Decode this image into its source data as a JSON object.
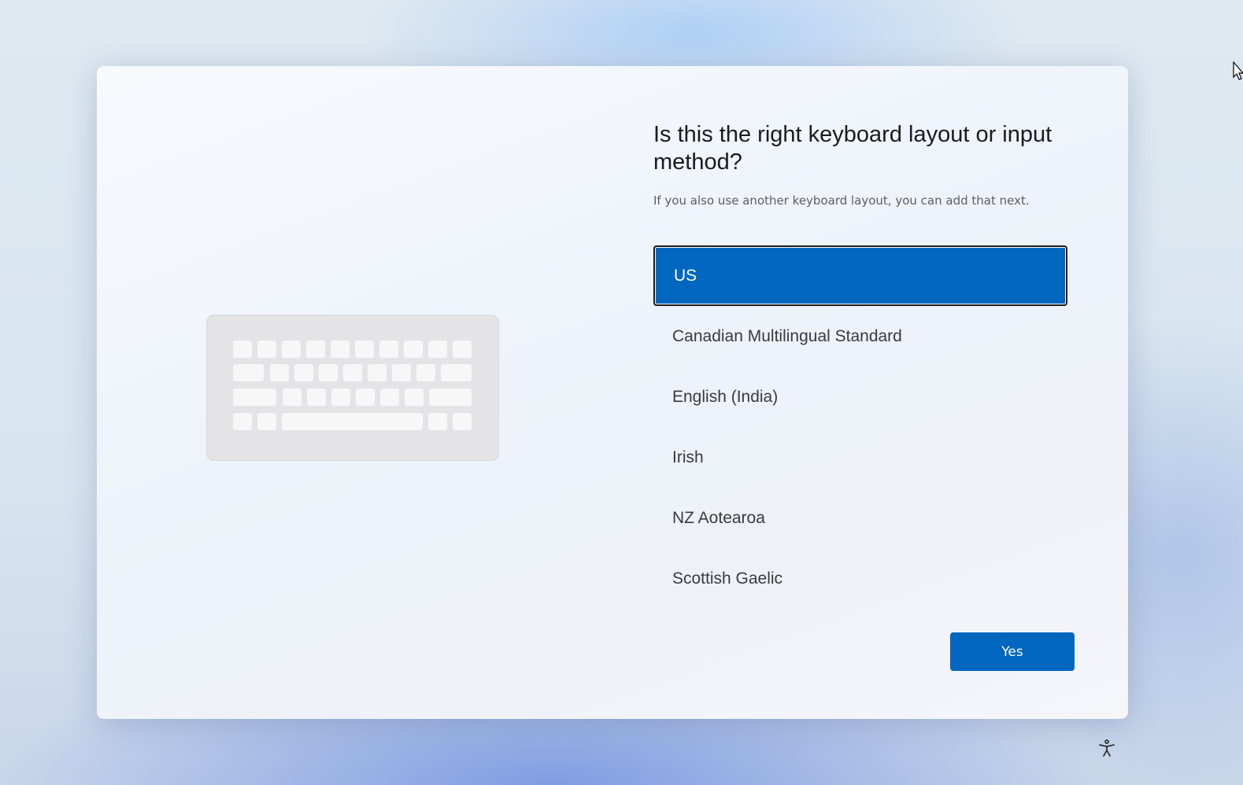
{
  "setup": {
    "title": "Is this the right keyboard layout or input method?",
    "subtitle": "If you also use another keyboard layout, you can add that next.",
    "layouts": [
      {
        "label": "US",
        "selected": true
      },
      {
        "label": "Canadian Multilingual Standard",
        "selected": false
      },
      {
        "label": "English (India)",
        "selected": false
      },
      {
        "label": "Irish",
        "selected": false
      },
      {
        "label": "NZ Aotearoa",
        "selected": false
      },
      {
        "label": "Scottish Gaelic",
        "selected": false
      }
    ],
    "yes_label": "Yes"
  },
  "icons": {
    "illustration": "keyboard-icon",
    "accessibility": "accessibility-icon",
    "cursor": "mouse-pointer-icon"
  },
  "colors": {
    "accent": "#0067c0",
    "selected_text": "#ffffff"
  }
}
